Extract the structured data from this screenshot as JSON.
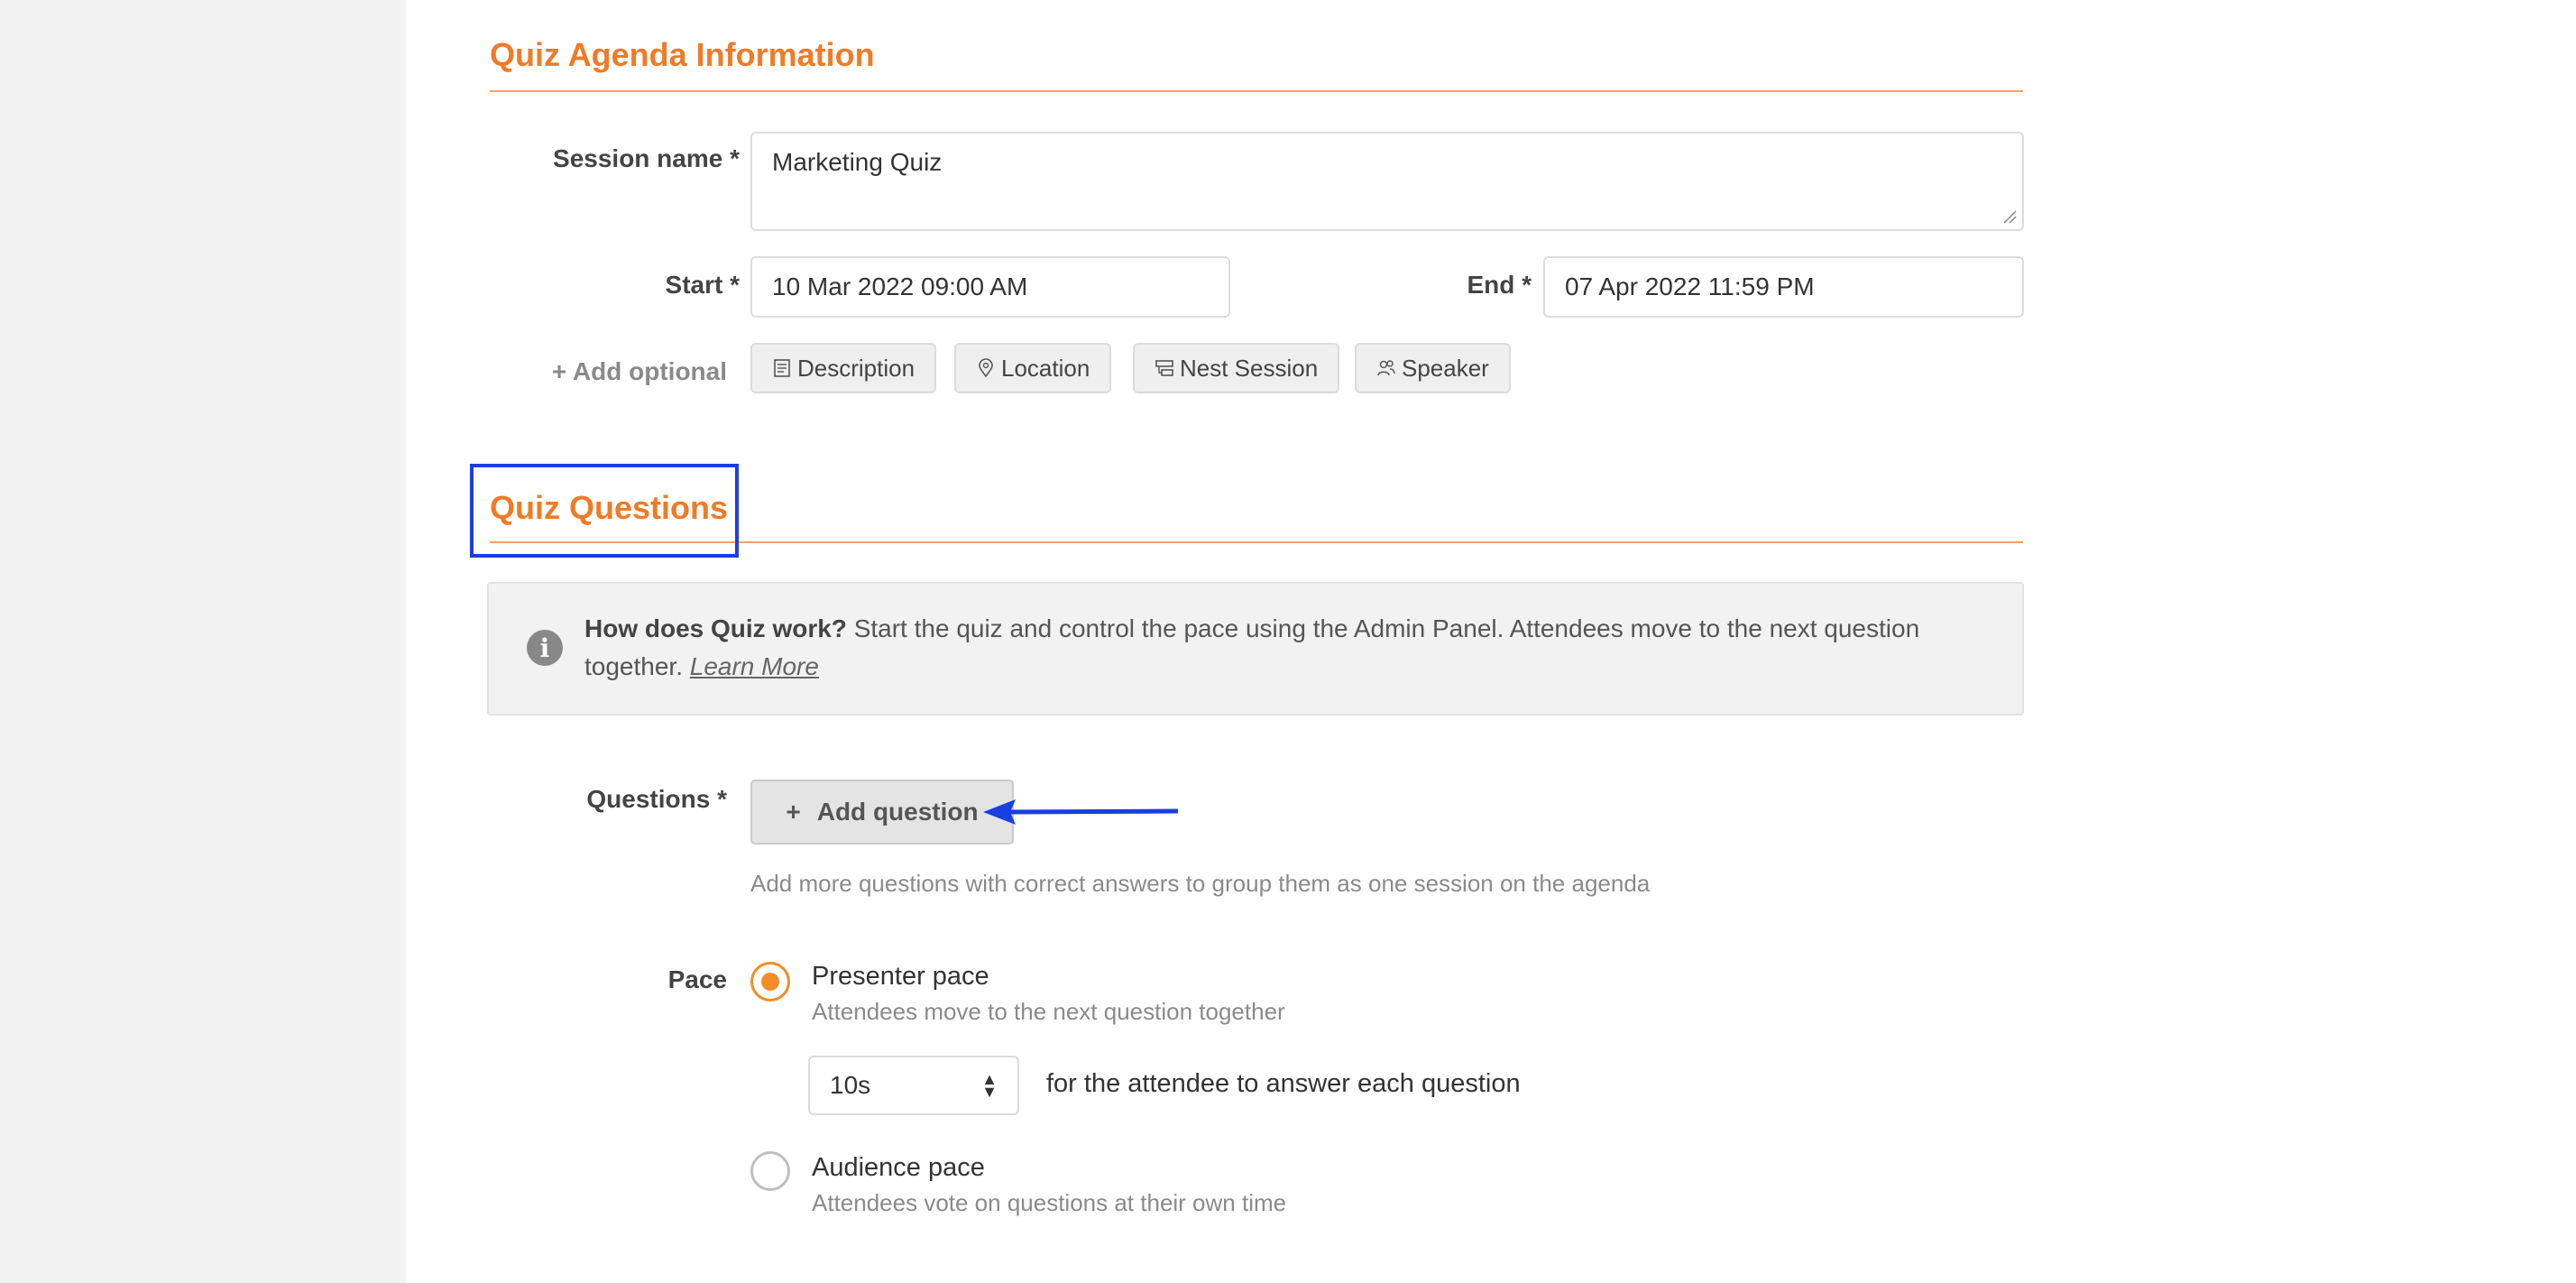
{
  "agenda_section": {
    "title": "Quiz Agenda Information",
    "session_name_label": "Session name *",
    "session_name_value": "Marketing Quiz",
    "start_label": "Start *",
    "start_value": "10 Mar 2022 09:00 AM",
    "end_label": "End *",
    "end_value": "07 Apr 2022 11:59 PM",
    "add_optional_label": "+ Add optional",
    "optional_buttons": [
      "Description",
      "Location",
      "Nest Session",
      "Speaker"
    ]
  },
  "questions_section": {
    "title": "Quiz Questions",
    "info": {
      "bold": "How does Quiz work?",
      "text": " Start the quiz and control the pace using the Admin Panel. Attendees move to the next question together. ",
      "link": "Learn More"
    },
    "questions_label": "Questions *",
    "add_question_plus": "+",
    "add_question_label": "Add question",
    "questions_hint": "Add more questions with correct answers to group them as one session on the agenda",
    "pace_label": "Pace",
    "presenter_pace": {
      "title": "Presenter pace",
      "subtitle": "Attendees move to the next question together",
      "selected": true
    },
    "timer_value": "10s",
    "timer_suffix": "for the attendee to answer each question",
    "audience_pace": {
      "title": "Audience pace",
      "subtitle": "Attendees vote on questions at their own time",
      "selected": false
    }
  },
  "colors": {
    "accent": "#f07b27",
    "highlight_box": "#1a3fe0",
    "annotation_arrow": "#1a3fe0"
  }
}
